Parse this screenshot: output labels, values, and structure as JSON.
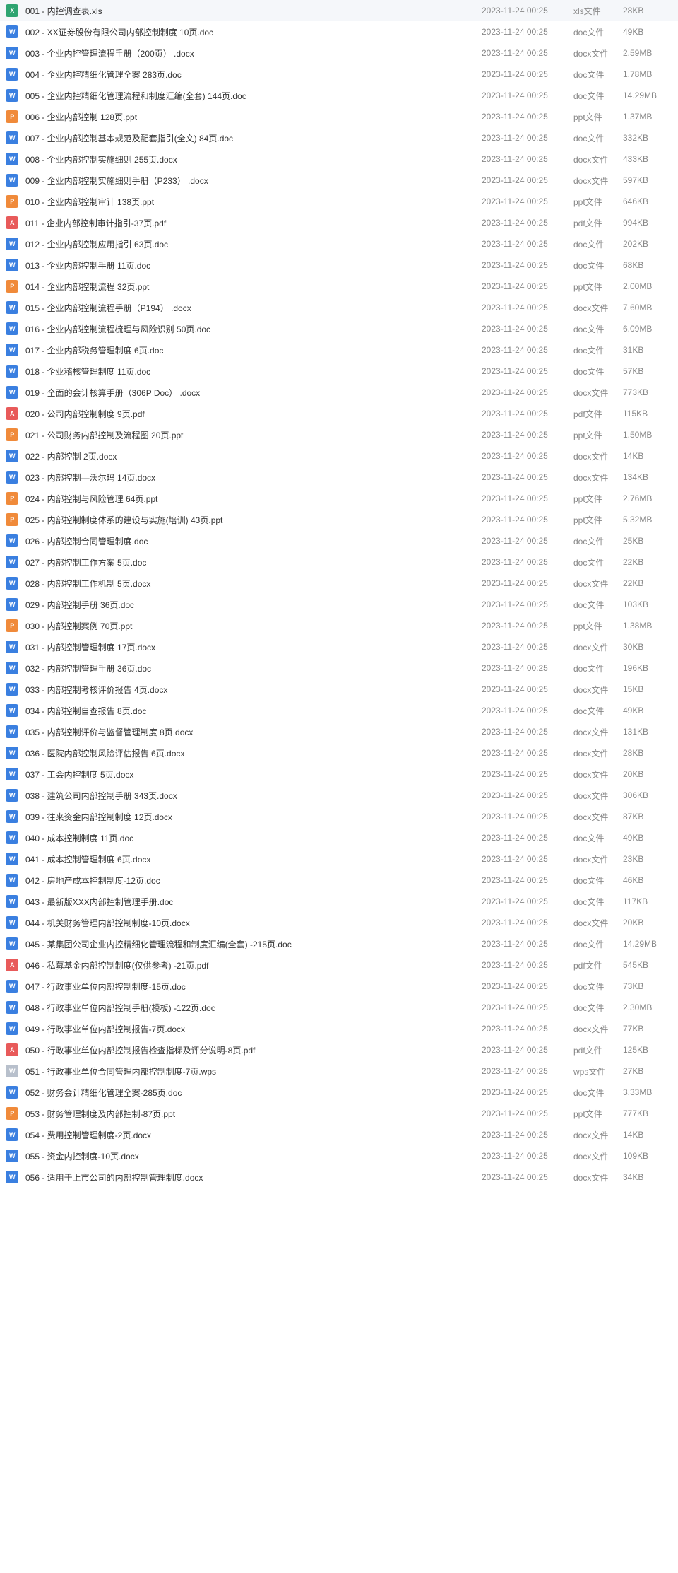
{
  "icon_letters": {
    "xls": "X",
    "doc": "W",
    "docx": "W",
    "ppt": "P",
    "pdf": "A",
    "wps": "W"
  },
  "files": [
    {
      "name": "001 - 内控调查表.xls",
      "date": "2023-11-24 00:25",
      "ext": "xls",
      "type": "xls文件",
      "size": "28KB"
    },
    {
      "name": "002 - XX证券股份有限公司内部控制制度 10页.doc",
      "date": "2023-11-24 00:25",
      "ext": "doc",
      "type": "doc文件",
      "size": "49KB"
    },
    {
      "name": "003 - 企业内控管理流程手册（200页） .docx",
      "date": "2023-11-24 00:25",
      "ext": "docx",
      "type": "docx文件",
      "size": "2.59MB"
    },
    {
      "name": "004 - 企业内控精细化管理全案 283页.doc",
      "date": "2023-11-24 00:25",
      "ext": "doc",
      "type": "doc文件",
      "size": "1.78MB"
    },
    {
      "name": "005 - 企业内控精细化管理流程和制度汇编(全套) 144页.doc",
      "date": "2023-11-24 00:25",
      "ext": "doc",
      "type": "doc文件",
      "size": "14.29MB"
    },
    {
      "name": "006 - 企业内部控制 128页.ppt",
      "date": "2023-11-24 00:25",
      "ext": "ppt",
      "type": "ppt文件",
      "size": "1.37MB"
    },
    {
      "name": "007 - 企业内部控制基本规范及配套指引(全文) 84页.doc",
      "date": "2023-11-24 00:25",
      "ext": "doc",
      "type": "doc文件",
      "size": "332KB"
    },
    {
      "name": "008 - 企业内部控制实施细则 255页.docx",
      "date": "2023-11-24 00:25",
      "ext": "docx",
      "type": "docx文件",
      "size": "433KB"
    },
    {
      "name": "009 - 企业内部控制实施细则手册（P233） .docx",
      "date": "2023-11-24 00:25",
      "ext": "docx",
      "type": "docx文件",
      "size": "597KB"
    },
    {
      "name": "010 - 企业内部控制审计 138页.ppt",
      "date": "2023-11-24 00:25",
      "ext": "ppt",
      "type": "ppt文件",
      "size": "646KB"
    },
    {
      "name": "011 - 企业内部控制审计指引-37页.pdf",
      "date": "2023-11-24 00:25",
      "ext": "pdf",
      "type": "pdf文件",
      "size": "994KB"
    },
    {
      "name": "012 - 企业内部控制应用指引 63页.doc",
      "date": "2023-11-24 00:25",
      "ext": "doc",
      "type": "doc文件",
      "size": "202KB"
    },
    {
      "name": "013 - 企业内部控制手册 11页.doc",
      "date": "2023-11-24 00:25",
      "ext": "doc",
      "type": "doc文件",
      "size": "68KB"
    },
    {
      "name": "014 - 企业内部控制流程 32页.ppt",
      "date": "2023-11-24 00:25",
      "ext": "ppt",
      "type": "ppt文件",
      "size": "2.00MB"
    },
    {
      "name": "015 - 企业内部控制流程手册（P194） .docx",
      "date": "2023-11-24 00:25",
      "ext": "docx",
      "type": "docx文件",
      "size": "7.60MB"
    },
    {
      "name": "016 - 企业内部控制流程梳理与风险识别 50页.doc",
      "date": "2023-11-24 00:25",
      "ext": "doc",
      "type": "doc文件",
      "size": "6.09MB"
    },
    {
      "name": "017 - 企业内部税务管理制度 6页.doc",
      "date": "2023-11-24 00:25",
      "ext": "doc",
      "type": "doc文件",
      "size": "31KB"
    },
    {
      "name": "018 - 企业稽核管理制度 11页.doc",
      "date": "2023-11-24 00:25",
      "ext": "doc",
      "type": "doc文件",
      "size": "57KB"
    },
    {
      "name": "019 - 全面的会计核算手册（306P Doc） .docx",
      "date": "2023-11-24 00:25",
      "ext": "docx",
      "type": "docx文件",
      "size": "773KB"
    },
    {
      "name": "020 - 公司内部控制制度 9页.pdf",
      "date": "2023-11-24 00:25",
      "ext": "pdf",
      "type": "pdf文件",
      "size": "115KB"
    },
    {
      "name": "021 - 公司财务内部控制及流程图 20页.ppt",
      "date": "2023-11-24 00:25",
      "ext": "ppt",
      "type": "ppt文件",
      "size": "1.50MB"
    },
    {
      "name": "022 - 内部控制 2页.docx",
      "date": "2023-11-24 00:25",
      "ext": "docx",
      "type": "docx文件",
      "size": "14KB"
    },
    {
      "name": "023 - 内部控制—沃尔玛 14页.docx",
      "date": "2023-11-24 00:25",
      "ext": "docx",
      "type": "docx文件",
      "size": "134KB"
    },
    {
      "name": "024 - 内部控制与风险管理 64页.ppt",
      "date": "2023-11-24 00:25",
      "ext": "ppt",
      "type": "ppt文件",
      "size": "2.76MB"
    },
    {
      "name": "025 - 内部控制制度体系的建设与实施(培训) 43页.ppt",
      "date": "2023-11-24 00:25",
      "ext": "ppt",
      "type": "ppt文件",
      "size": "5.32MB"
    },
    {
      "name": "026 - 内部控制合同管理制度.doc",
      "date": "2023-11-24 00:25",
      "ext": "doc",
      "type": "doc文件",
      "size": "25KB"
    },
    {
      "name": "027 - 内部控制工作方案 5页.doc",
      "date": "2023-11-24 00:25",
      "ext": "doc",
      "type": "doc文件",
      "size": "22KB"
    },
    {
      "name": "028 - 内部控制工作机制 5页.docx",
      "date": "2023-11-24 00:25",
      "ext": "docx",
      "type": "docx文件",
      "size": "22KB"
    },
    {
      "name": "029 - 内部控制手册 36页.doc",
      "date": "2023-11-24 00:25",
      "ext": "doc",
      "type": "doc文件",
      "size": "103KB"
    },
    {
      "name": "030 - 内部控制案例 70页.ppt",
      "date": "2023-11-24 00:25",
      "ext": "ppt",
      "type": "ppt文件",
      "size": "1.38MB"
    },
    {
      "name": "031 - 内部控制管理制度 17页.docx",
      "date": "2023-11-24 00:25",
      "ext": "docx",
      "type": "docx文件",
      "size": "30KB"
    },
    {
      "name": "032 - 内部控制管理手册 36页.doc",
      "date": "2023-11-24 00:25",
      "ext": "doc",
      "type": "doc文件",
      "size": "196KB"
    },
    {
      "name": "033 - 内部控制考核评价报告 4页.docx",
      "date": "2023-11-24 00:25",
      "ext": "docx",
      "type": "docx文件",
      "size": "15KB"
    },
    {
      "name": "034 - 内部控制自查报告 8页.doc",
      "date": "2023-11-24 00:25",
      "ext": "doc",
      "type": "doc文件",
      "size": "49KB"
    },
    {
      "name": "035 - 内部控制评价与监督管理制度 8页.docx",
      "date": "2023-11-24 00:25",
      "ext": "docx",
      "type": "docx文件",
      "size": "131KB"
    },
    {
      "name": "036 - 医院内部控制风险评估报告 6页.docx",
      "date": "2023-11-24 00:25",
      "ext": "docx",
      "type": "docx文件",
      "size": "28KB"
    },
    {
      "name": "037 - 工会内控制度 5页.docx",
      "date": "2023-11-24 00:25",
      "ext": "docx",
      "type": "docx文件",
      "size": "20KB"
    },
    {
      "name": "038 - 建筑公司内部控制手册 343页.docx",
      "date": "2023-11-24 00:25",
      "ext": "docx",
      "type": "docx文件",
      "size": "306KB"
    },
    {
      "name": "039 - 往来资金内部控制制度 12页.docx",
      "date": "2023-11-24 00:25",
      "ext": "docx",
      "type": "docx文件",
      "size": "87KB"
    },
    {
      "name": "040 - 成本控制制度 11页.doc",
      "date": "2023-11-24 00:25",
      "ext": "doc",
      "type": "doc文件",
      "size": "49KB"
    },
    {
      "name": "041 - 成本控制管理制度 6页.docx",
      "date": "2023-11-24 00:25",
      "ext": "docx",
      "type": "docx文件",
      "size": "23KB"
    },
    {
      "name": "042 - 房地产成本控制制度-12页.doc",
      "date": "2023-11-24 00:25",
      "ext": "doc",
      "type": "doc文件",
      "size": "46KB"
    },
    {
      "name": "043 - 最新版XXX内部控制管理手册.doc",
      "date": "2023-11-24 00:25",
      "ext": "doc",
      "type": "doc文件",
      "size": "117KB"
    },
    {
      "name": "044 - 机关财务管理内部控制制度-10页.docx",
      "date": "2023-11-24 00:25",
      "ext": "docx",
      "type": "docx文件",
      "size": "20KB"
    },
    {
      "name": "045 - 某集团公司企业内控精细化管理流程和制度汇编(全套) -215页.doc",
      "date": "2023-11-24 00:25",
      "ext": "doc",
      "type": "doc文件",
      "size": "14.29MB"
    },
    {
      "name": "046 - 私募基金内部控制制度(仅供参考) -21页.pdf",
      "date": "2023-11-24 00:25",
      "ext": "pdf",
      "type": "pdf文件",
      "size": "545KB"
    },
    {
      "name": "047 - 行政事业单位内部控制制度-15页.doc",
      "date": "2023-11-24 00:25",
      "ext": "doc",
      "type": "doc文件",
      "size": "73KB"
    },
    {
      "name": "048 - 行政事业单位内部控制手册(模板) -122页.doc",
      "date": "2023-11-24 00:25",
      "ext": "doc",
      "type": "doc文件",
      "size": "2.30MB"
    },
    {
      "name": "049 - 行政事业单位内部控制报告-7页.docx",
      "date": "2023-11-24 00:25",
      "ext": "docx",
      "type": "docx文件",
      "size": "77KB"
    },
    {
      "name": "050 - 行政事业单位内部控制报告检查指标及评分说明-8页.pdf",
      "date": "2023-11-24 00:25",
      "ext": "pdf",
      "type": "pdf文件",
      "size": "125KB"
    },
    {
      "name": "051 - 行政事业单位合同管理内部控制制度-7页.wps",
      "date": "2023-11-24 00:25",
      "ext": "wps",
      "type": "wps文件",
      "size": "27KB"
    },
    {
      "name": "052 - 财务会计精细化管理全案-285页.doc",
      "date": "2023-11-24 00:25",
      "ext": "doc",
      "type": "doc文件",
      "size": "3.33MB"
    },
    {
      "name": "053 - 财务管理制度及内部控制-87页.ppt",
      "date": "2023-11-24 00:25",
      "ext": "ppt",
      "type": "ppt文件",
      "size": "777KB"
    },
    {
      "name": "054 - 费用控制管理制度-2页.docx",
      "date": "2023-11-24 00:25",
      "ext": "docx",
      "type": "docx文件",
      "size": "14KB"
    },
    {
      "name": "055 - 资金内控制度-10页.docx",
      "date": "2023-11-24 00:25",
      "ext": "docx",
      "type": "docx文件",
      "size": "109KB"
    },
    {
      "name": "056 - 适用于上市公司的内部控制管理制度.docx",
      "date": "2023-11-24 00:25",
      "ext": "docx",
      "type": "docx文件",
      "size": "34KB"
    }
  ]
}
